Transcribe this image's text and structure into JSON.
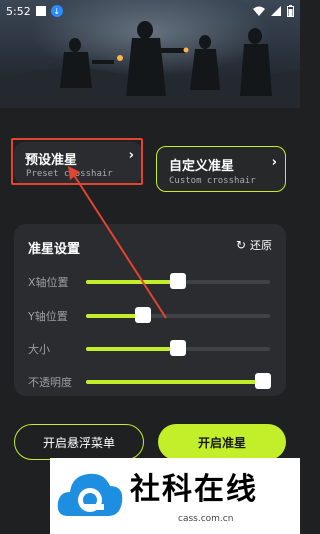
{
  "status_bar": {
    "time": "5:52",
    "icons": [
      "app-square-icon",
      "download-icon",
      "wifi-icon",
      "signal-icon",
      "battery-icon"
    ]
  },
  "preset_card": {
    "title": "预设准星",
    "subtitle": "Preset crosshair",
    "arrow": "›"
  },
  "custom_card": {
    "title": "自定义准星",
    "subtitle": "Custom crosshair",
    "arrow": "›"
  },
  "settings": {
    "title": "准星设置",
    "reset_label": "还原",
    "rows": [
      {
        "label": "X轴位置",
        "value": 0.5
      },
      {
        "label": "Y轴位置",
        "value": 0.31
      },
      {
        "label": "大小",
        "value": 0.5
      },
      {
        "label": "不透明度",
        "value": 0.96
      }
    ]
  },
  "buttons": {
    "floating_menu": "开启悬浮菜单",
    "start": "开启准星"
  },
  "watermark": {
    "text": "社科在线",
    "url": "cass.com.cn"
  },
  "colors": {
    "accent": "#c2ef2a",
    "background": "#1f2022",
    "card": "#2a2c2f",
    "highlight": "#e3432f"
  }
}
